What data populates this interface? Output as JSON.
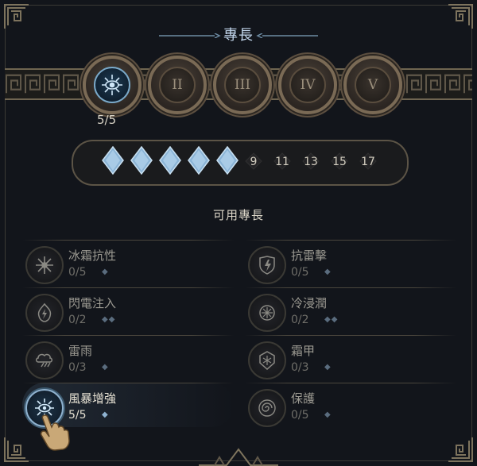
{
  "title": "專長",
  "tiers": {
    "count": "5/5",
    "items": [
      {
        "label": "",
        "state": "active",
        "icon": "eye-snowflake-icon"
      },
      {
        "label": "II",
        "state": "locked"
      },
      {
        "label": "III",
        "state": "locked"
      },
      {
        "label": "IV",
        "state": "locked"
      },
      {
        "label": "V",
        "state": "locked"
      }
    ]
  },
  "progress": {
    "filled_diamonds": 5,
    "levels": [
      "9",
      "11",
      "13",
      "15",
      "17"
    ]
  },
  "section_title": "可用專長",
  "perks": [
    {
      "name": "冰霜抗性",
      "count": "0/5",
      "pips": "◆",
      "icon": "snowflake-icon",
      "active": false
    },
    {
      "name": "抗雷擊",
      "count": "0/5",
      "pips": "◆",
      "icon": "lightning-shield-icon",
      "active": false
    },
    {
      "name": "閃電注入",
      "count": "0/2",
      "pips": "◆◆",
      "icon": "lightning-flame-icon",
      "active": false
    },
    {
      "name": "冷浸潤",
      "count": "0/2",
      "pips": "◆◆",
      "icon": "frost-orb-icon",
      "active": false
    },
    {
      "name": "雷雨",
      "count": "0/3",
      "pips": "◆",
      "icon": "storm-cloud-icon",
      "active": false
    },
    {
      "name": "霜甲",
      "count": "0/3",
      "pips": "◆",
      "icon": "frost-armor-icon",
      "active": false
    },
    {
      "name": "風暴增強",
      "count": "5/5",
      "pips": "◆",
      "icon": "eye-snowflake-icon",
      "active": true
    },
    {
      "name": "保護",
      "count": "0/5",
      "pips": "◆",
      "icon": "spiral-shield-icon",
      "active": false
    }
  ],
  "colors": {
    "accent": "#8fb3d1",
    "gold": "#7a6a55"
  }
}
